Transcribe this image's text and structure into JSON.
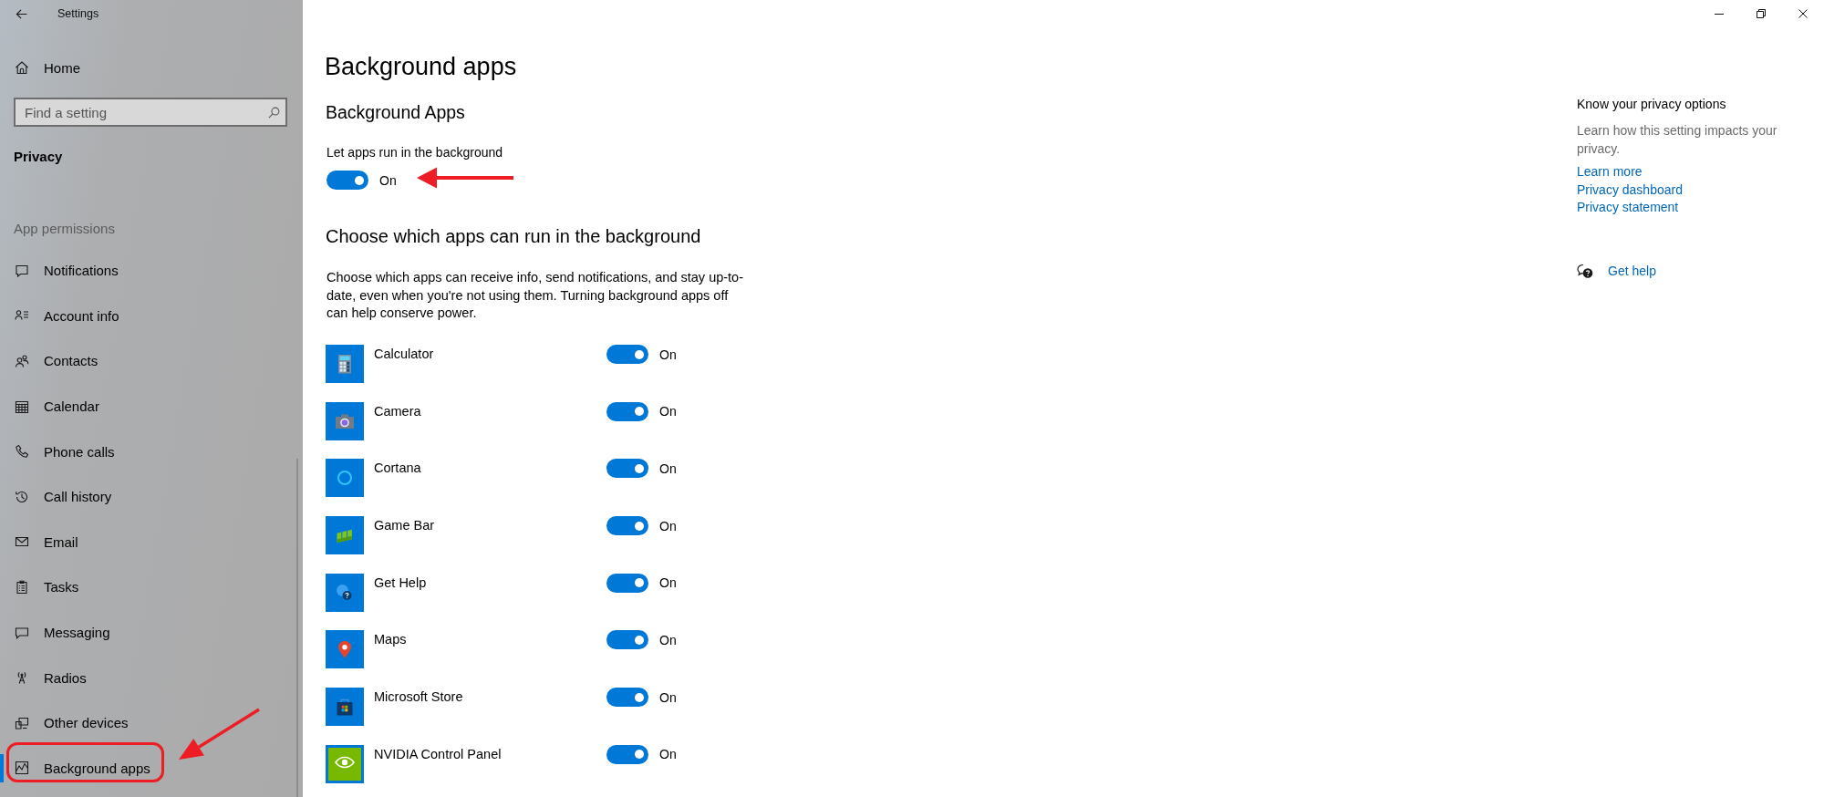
{
  "window": {
    "title": "Settings"
  },
  "sidebar": {
    "home": "Home",
    "search": {
      "placeholder": "Find a setting"
    },
    "section": "Privacy",
    "group_label": "App permissions",
    "items": [
      {
        "label": "Notifications",
        "selected": false
      },
      {
        "label": "Account info",
        "selected": false
      },
      {
        "label": "Contacts",
        "selected": false
      },
      {
        "label": "Calendar",
        "selected": false
      },
      {
        "label": "Phone calls",
        "selected": false
      },
      {
        "label": "Call history",
        "selected": false
      },
      {
        "label": "Email",
        "selected": false
      },
      {
        "label": "Tasks",
        "selected": false
      },
      {
        "label": "Messaging",
        "selected": false
      },
      {
        "label": "Radios",
        "selected": false
      },
      {
        "label": "Other devices",
        "selected": false
      },
      {
        "label": "Background apps",
        "selected": true
      }
    ]
  },
  "page": {
    "title": "Background apps",
    "master": {
      "heading": "Background Apps",
      "label": "Let apps run in the background",
      "on": true,
      "state_text": "On"
    },
    "apps_section": {
      "heading": "Choose which apps can run in the background",
      "description": "Choose which apps can receive info, send notifications, and stay up-to-date, even when you're not using them. Turning background apps off can help conserve power.",
      "apps": [
        {
          "name": "Calculator",
          "on": true,
          "state_text": "On"
        },
        {
          "name": "Camera",
          "on": true,
          "state_text": "On"
        },
        {
          "name": "Cortana",
          "on": true,
          "state_text": "On"
        },
        {
          "name": "Game Bar",
          "on": true,
          "state_text": "On"
        },
        {
          "name": "Get Help",
          "on": true,
          "state_text": "On"
        },
        {
          "name": "Maps",
          "on": true,
          "state_text": "On"
        },
        {
          "name": "Microsoft Store",
          "on": true,
          "state_text": "On"
        },
        {
          "name": "NVIDIA Control Panel",
          "on": true,
          "state_text": "On"
        }
      ]
    }
  },
  "aside": {
    "heading": "Know your privacy options",
    "text": "Learn how this setting impacts your privacy.",
    "links": [
      "Learn more",
      "Privacy dashboard",
      "Privacy statement"
    ],
    "help": "Get help"
  }
}
